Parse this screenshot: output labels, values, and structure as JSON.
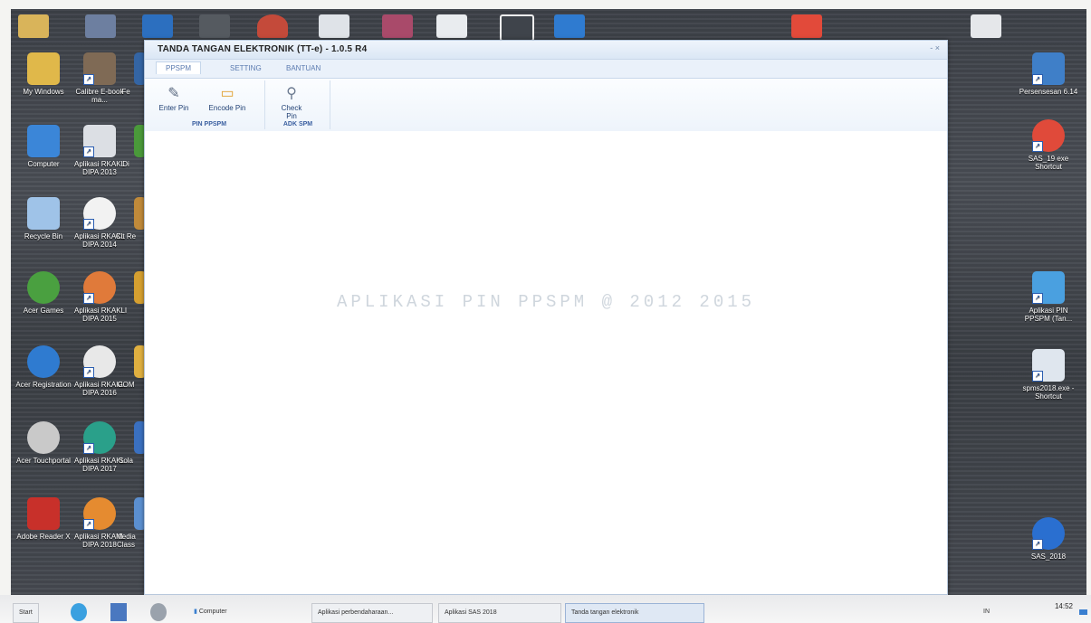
{
  "window": {
    "title": "TANDA TANGAN ELEKTRONIK (TT-e) - 1.0.5 R4",
    "controls": "- ×",
    "tabs": [
      "PPSPM",
      "SETTING",
      "BANTUAN"
    ],
    "ribbon": {
      "groups": [
        {
          "label": "PIN PPSPM",
          "buttons": [
            "Enter Pin",
            "Encode Pin"
          ]
        },
        {
          "label": "ADK SPM",
          "buttons": [
            "Check Pin"
          ]
        }
      ]
    },
    "watermark": "APLIKASI PIN PPSPM @ 2012 2015"
  },
  "desktop": {
    "left_icons": [
      [
        "My Windows",
        "Calibre E-book ma...",
        "Fe"
      ],
      [
        "Computer",
        "Aplikasi RKAKL DIPA 2013",
        "Di"
      ],
      [
        "Recycle Bin",
        "Aplikasi RKAKL DIPA 2014",
        "Cit Re"
      ],
      [
        "Acer Games",
        "Aplikasi RKAKL DIPA 2015",
        "I"
      ],
      [
        "Acer Registration",
        "Aplikasi RKAKL DIPA 2016",
        "GOM"
      ],
      [
        "Acer Touchportal",
        "Aplikasi RKAKL DIPA 2017",
        "Sola"
      ],
      [
        "Adobe Reader X",
        "Aplikasi RKAKL DIPA 2018",
        "Media Class"
      ]
    ],
    "right_icons": [
      "Persensesan 6.14",
      "SAS_19 exe Shortcut",
      "Aplikasi PIN PPSPM (Tan...",
      "spms2018.exe - Shortcut",
      "SAS_2018"
    ]
  },
  "taskbar": {
    "start": "Start",
    "quick_launch": [
      "Computer"
    ],
    "items": [
      "Aplikasi perbendaharaan...",
      "Aplikasi SAS 2018",
      "Tanda tangan elektronik"
    ],
    "clock": "14:52",
    "lang": "IN"
  },
  "colors": {
    "accent": "#3a5fa0",
    "desktop": "#43474e"
  }
}
